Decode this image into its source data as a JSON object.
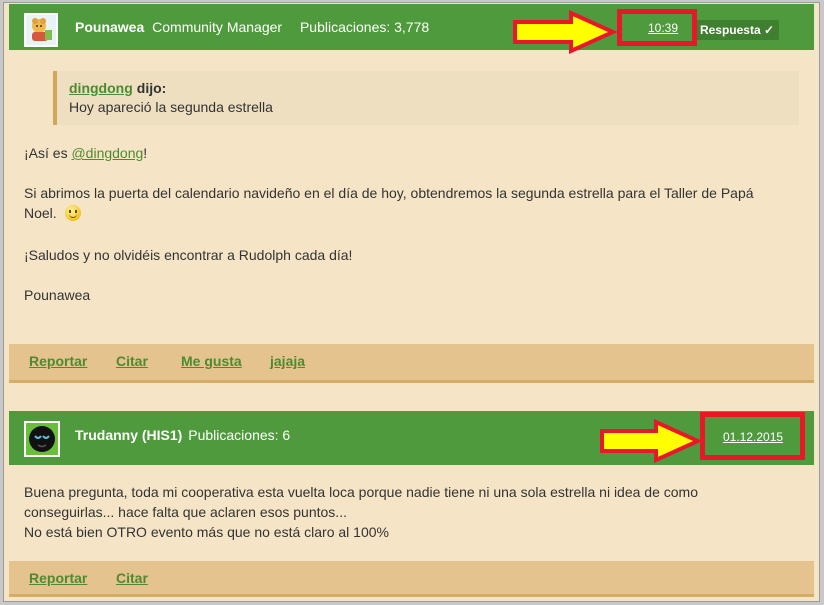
{
  "posts": [
    {
      "username": "Pounawea",
      "role": "Community Manager",
      "posts_label": "Publicaciones: 3,778",
      "time": "10:39",
      "solution_label": "Respuesta ✓",
      "quote": {
        "author": "dingdong",
        "said": "dijo:",
        "text": "Hoy apareció la segunda estrella"
      },
      "greeting_prefix": "¡Así es ",
      "mention": "@dingdong",
      "greeting_suffix": "!",
      "paragraph_1": "Si abrimos la puerta del calendario navideño en el día de hoy, obtendremos la segunda estrella para el Taller de Papá Noel.",
      "paragraph_2": "¡Saludos y no olvidéis encontrar a Rudolph cada día!",
      "signature": "Pounawea",
      "actions": [
        "Reportar",
        "Citar",
        "Me gusta",
        "jajaja"
      ]
    },
    {
      "username": "Trudanny (HIS1)",
      "posts_label": "Publicaciones: 6",
      "date": "01.12.2015",
      "line_1": "Buena pregunta, toda mi cooperativa esta vuelta loca porque nadie tiene ni una sola estrella ni idea de como",
      "line_2": "conseguirlas... hace falta que aclaren esos puntos...",
      "line_3": "No está bien OTRO evento más que no está claro al 100%",
      "actions": [
        "Reportar",
        "Citar"
      ]
    }
  ],
  "colors": {
    "header_green": "#4f9a3c",
    "post_background": "#f5e5c6",
    "action_bar": "#e5c38e",
    "link_green": "#4f8a30",
    "annotation_red": "#e8182a",
    "annotation_arrow": "#ffff00"
  },
  "annotations": {
    "arrow_icon": "right-arrow-icon",
    "highlight": "red-box"
  }
}
